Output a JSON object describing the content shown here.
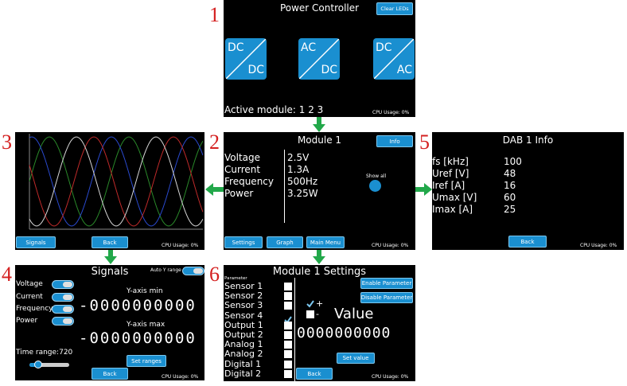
{
  "numbers": [
    "1",
    "2",
    "3",
    "4",
    "5",
    "6"
  ],
  "screen1": {
    "title": "Power Controller",
    "clear_leds": "Clear LEDs",
    "tiles": [
      {
        "top": "DC",
        "bottom": "DC"
      },
      {
        "top": "AC",
        "bottom": "DC"
      },
      {
        "top": "DC",
        "bottom": "AC"
      }
    ],
    "active_module": "Active module: 1 2 3",
    "cpu": "CPU Usage: 0%"
  },
  "screen2": {
    "title": "Module 1",
    "info_btn": "Info",
    "labels": [
      "Voltage",
      "Current",
      "Frequency",
      "Power"
    ],
    "values": [
      "2.5V",
      "1.3A",
      "500Hz",
      "3.25W"
    ],
    "show_all": "Show all",
    "settings_btn": "Settings",
    "graph_btn": "Graph",
    "main_menu_btn": "Main Menu",
    "cpu": "CPU Usage: 0%"
  },
  "screen3": {
    "signals_btn": "Signals",
    "back_btn": "Back",
    "cpu": "CPU Usage: 0%",
    "colors": [
      "#2a8a2a",
      "#2a4ad0",
      "#c02a2a",
      "#d8d8d8"
    ]
  },
  "screen4": {
    "title": "Signals",
    "auto_y": "Auto Y range",
    "signals": [
      "Voltage",
      "Current",
      "Frequency",
      "Power"
    ],
    "ymin_label": "Y-axis min",
    "ymin_value": "-0000000000",
    "ymax_label": "Y-axis max",
    "ymax_value": "-0000000000",
    "time_range": "Time range:720",
    "set_ranges": "Set ranges",
    "back_btn": "Back",
    "cpu": "CPU Usage: 0%"
  },
  "screen5": {
    "title": "DAB 1 Info",
    "labels": [
      "fs [kHz]",
      "Uref [V]",
      "Iref [A]",
      "Umax [V]",
      "Imax [A]"
    ],
    "values": [
      "100",
      "48",
      "16",
      "60",
      "25"
    ],
    "back_btn": "Back",
    "cpu": "CPU Usage: 0%"
  },
  "screen6": {
    "title": "Module 1 Settings",
    "param_header": "Parameter",
    "params": [
      "Sensor 1",
      "Sensor 2",
      "Sensor 3",
      "Sensor 4",
      "Output 1",
      "Output 2",
      "Analog 1",
      "Analog 2",
      "Digital 1",
      "Digital 2"
    ],
    "checked_index": 3,
    "enable_btn": "Enable Parameter",
    "disable_btn": "Disable Parameter",
    "plus": "+",
    "minus": "-",
    "value_label": "Value",
    "value_digits": "0000000000",
    "set_value": "Set value",
    "back_btn": "Back",
    "cpu": "CPU Usage: 0%"
  },
  "arrow_color": "#22a84a",
  "accent": "#1a8fd0"
}
